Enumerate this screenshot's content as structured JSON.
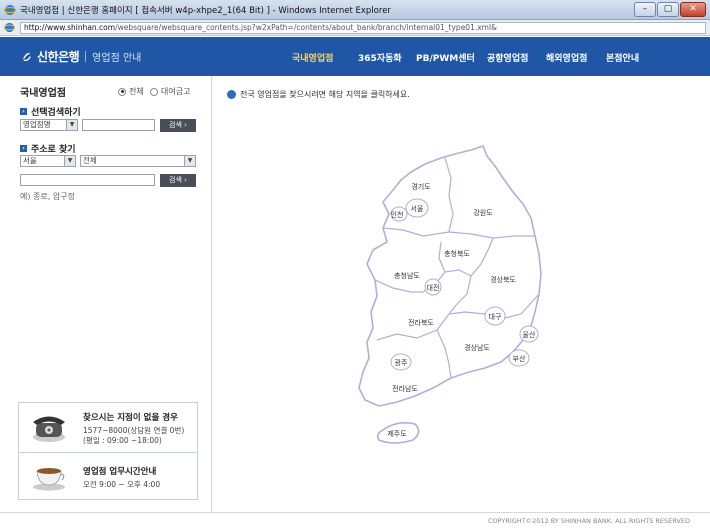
{
  "window": {
    "title": "국내영업점 | 신한은행 홈페이지 [ 접속서버 w4p-xhpe2_1(64 Bit) ] - Windows Internet Explorer"
  },
  "address": {
    "host": "http://www.shinhan.com",
    "path": "/websquare/websquare_contents.jsp?w2xPath=/contents/about_bank/branch/internal01_type01.xml&"
  },
  "header": {
    "logo_text": "신한은행",
    "logo_subtitle": "영업점 안내",
    "menu": [
      "국내영업점",
      "365자동화",
      "PB/PWM센터",
      "공항영업점",
      "해외영업점",
      "본점안내"
    ],
    "active_menu": "국내영업점",
    "colors": {
      "nav_bg": "#1f56a6",
      "active": "#ffd35a"
    }
  },
  "sidebar": {
    "title": "국내영업점",
    "radio_all": "전체",
    "radio_other": "대여금고",
    "section_select": "선택검색하기",
    "select_type": "영업점명",
    "search_label": "검색",
    "section_address": "주소로 찾기",
    "select_city": "서울",
    "select_district": "전체",
    "example": "예) 종로, 압구정",
    "info_phone_title": "찾으시는 지점이 없을 경우",
    "info_phone_line1": "1577~8000(상담원 연결 0번)",
    "info_phone_line2": "(평일 : 09:00 ~18:00)",
    "info_hours_title": "영업점 업무시간안내",
    "info_hours_line": "오전 9:00 ~ 오후 4:00"
  },
  "main": {
    "notice": "전국 영업점을 찾으시려면 해당 지역을 클릭하세요.",
    "regions": {
      "gyeonggi": "경기도",
      "incheon": "인천",
      "seoul": "서울",
      "gangwon": "강원도",
      "chungbuk": "충청북도",
      "chungnam": "충청남도",
      "daejeon": "대전",
      "gyeongbuk": "경상북도",
      "daegu": "대구",
      "jeonbuk": "전라북도",
      "ulsan": "울산",
      "gyeongnam": "경상남도",
      "gwangju": "광주",
      "busan": "부산",
      "jeonnam": "전라남도",
      "jeju": "제주도"
    }
  },
  "footer": {
    "copyright": "COPYRIGHT©2012 BY SHINHAN BANK. ALL RIGHTS RESERVED"
  }
}
